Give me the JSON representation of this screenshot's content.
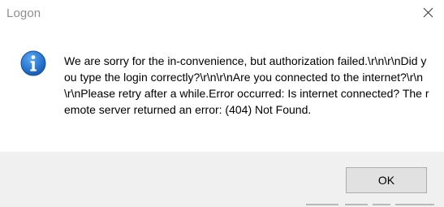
{
  "window": {
    "title": "Logon",
    "close_icon": "close-icon"
  },
  "dialog": {
    "icon": "info-icon",
    "message": "We are sorry for the in-convenience, but authorization failed.\\r\\n\\r\\nDid you type the login correctly?\\r\\n\\r\\nAre you connected to the internet?\\r\\n\\r\\nPlease retry after a while.Error occurred: Is internet connected? The remote server returned an error: (404) Not Found."
  },
  "buttons": {
    "ok_label": "OK"
  },
  "colors": {
    "icon_blue": "#1f6fc4",
    "footer_bg": "#f0f0f0",
    "title_text": "#8f8f8f"
  }
}
